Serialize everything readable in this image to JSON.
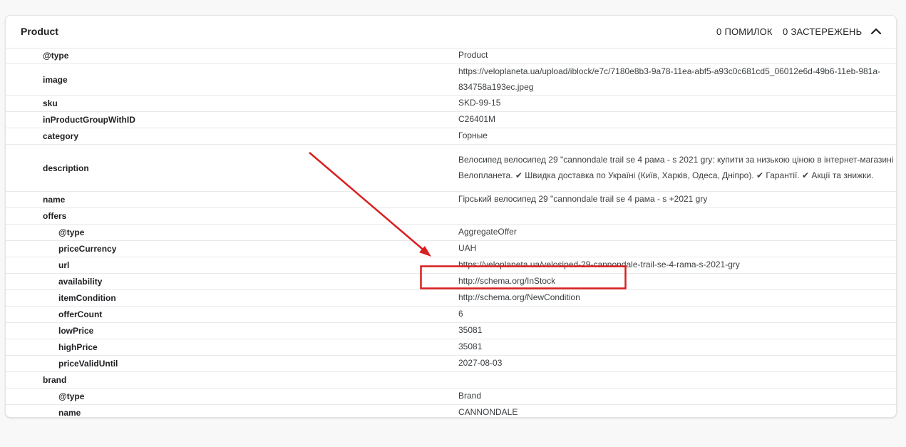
{
  "panel": {
    "title": "Product",
    "errors_count": "0",
    "errors_label": "ПОМИЛОК",
    "warnings_count": "0",
    "warnings_label": "ЗАСТЕРЕЖЕНЬ",
    "collapse_icon": "chevron-up-icon"
  },
  "rows": [
    {
      "name": "@type",
      "value": "Product"
    },
    {
      "name": "image",
      "value": "https://veloplaneta.ua/upload/iblock/e7c/7180e8b3-9a78-11ea-abf5-a93c0c681cd5_06012e6d-49b6-11eb-981a-834758a193ec.jpeg"
    },
    {
      "name": "sku",
      "value": "SKD-99-15"
    },
    {
      "name": "inProductGroupWithID",
      "value": "C26401M"
    },
    {
      "name": "category",
      "value": "Горные"
    },
    {
      "name": "description",
      "value": "Велосипед велосипед 29 \"cannondale trail se 4 рама - s 2021 gry: купити за низькою ціною в інтернет-магазині Велопланета. ✔ Швидка доставка по Україні (Київ, Харків, Одеса, Дніпро). ✔ Гарантії. ✔ Акції та знижки."
    },
    {
      "name": "name",
      "value": "Гірський велосипед 29 \"cannondale trail se 4 рама - s +2021 gry"
    },
    {
      "name": "offers",
      "value": ""
    },
    {
      "name": "@type",
      "value": "AggregateOffer"
    },
    {
      "name": "priceCurrency",
      "value": "UAH"
    },
    {
      "name": "url",
      "value": "https://veloplaneta.ua/velosiped-29-cannondale-trail-se-4-rama-s-2021-gry"
    },
    {
      "name": "availability",
      "value": "http://schema.org/InStock"
    },
    {
      "name": "itemCondition",
      "value": "http://schema.org/NewCondition"
    },
    {
      "name": "offerCount",
      "value": "6"
    },
    {
      "name": "lowPrice",
      "value": "35081"
    },
    {
      "name": "highPrice",
      "value": "35081"
    },
    {
      "name": "priceValidUntil",
      "value": "2027-08-03"
    },
    {
      "name": "brand",
      "value": ""
    },
    {
      "name": "@type",
      "value": "Brand"
    },
    {
      "name": "name",
      "value": "CANNONDALE"
    }
  ],
  "annotation": {
    "color": "#d91f1f",
    "highlighted_property": "availability"
  }
}
